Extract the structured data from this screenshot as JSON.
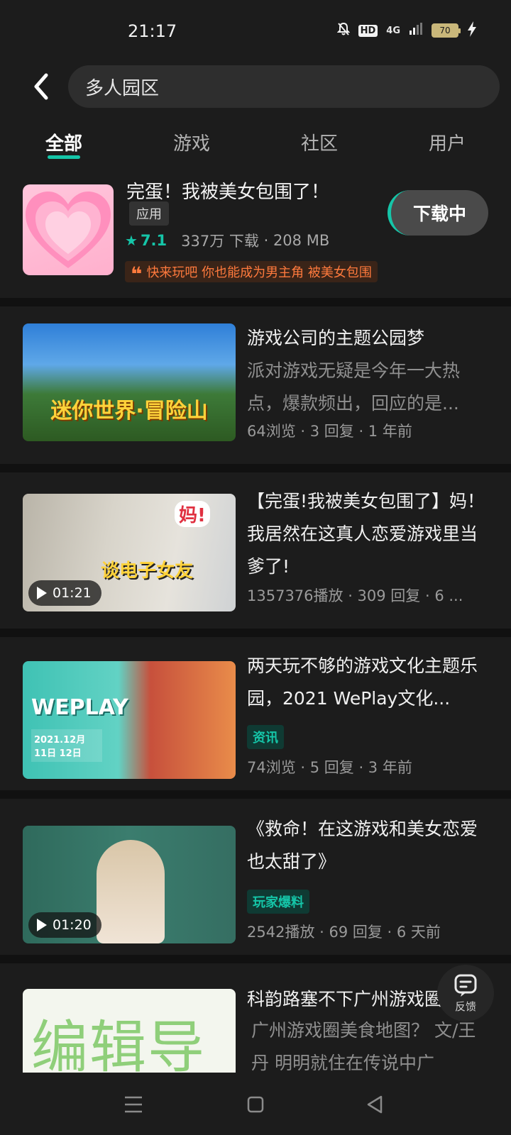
{
  "status": {
    "time": "21:17",
    "battery": "70",
    "network": "4G",
    "hd": "HD"
  },
  "search": {
    "query": "多人园区"
  },
  "tabs": [
    {
      "label": "全部",
      "active": true
    },
    {
      "label": "游戏",
      "active": false
    },
    {
      "label": "社区",
      "active": false
    },
    {
      "label": "用户",
      "active": false
    }
  ],
  "app": {
    "title": "完蛋！我被美女包围了！",
    "type": "应用",
    "rating": "7.1",
    "downloads": "337万 下载",
    "size": "208 MB",
    "quote": "快来玩吧 你也能成为男主角 被美女包围",
    "button": "下载中"
  },
  "feed": [
    {
      "thumb_text": "迷你世界·冒险山",
      "title": "游戏公司的主题公园梦",
      "desc": "派对游戏无疑是今年一大热点，爆款频出，回应的是...",
      "meta": "64浏览 · 3 回复 · 1 年前"
    },
    {
      "thumb_text": "谈电子女友",
      "thumb_text2": "妈!",
      "duration": "01:21",
      "title": "【完蛋!我被美女包围了】妈！我居然在这真人恋爱游戏里当爹了!",
      "meta": "1357376播放 · 309 回复 · 6 ..."
    },
    {
      "thumb_text": "WEPLAY",
      "thumb_date": "2021.12月 11日 12日",
      "title": "两天玩不够的游戏文化主题乐园，2021 WePlay文化...",
      "tag": "资讯",
      "meta": "74浏览 · 5 回复 · 3 年前"
    },
    {
      "duration": "01:20",
      "title": "《救命！在这游戏和美女恋爱也太甜了》",
      "tag": "玩家爆料",
      "meta": "2542播放 · 69 回复 · 6 天前"
    },
    {
      "thumb_text": "编辑导",
      "title": "科韵路塞不下广州游戏圈",
      "desc": "广州游戏圈美食地图？ 文/王丹 明明就住在传说中广"
    }
  ],
  "feedback": {
    "label": "反馈"
  },
  "colors": {
    "accent": "#15c5a8",
    "background": "#1c1c1c",
    "quote": "#ff7a3d"
  }
}
